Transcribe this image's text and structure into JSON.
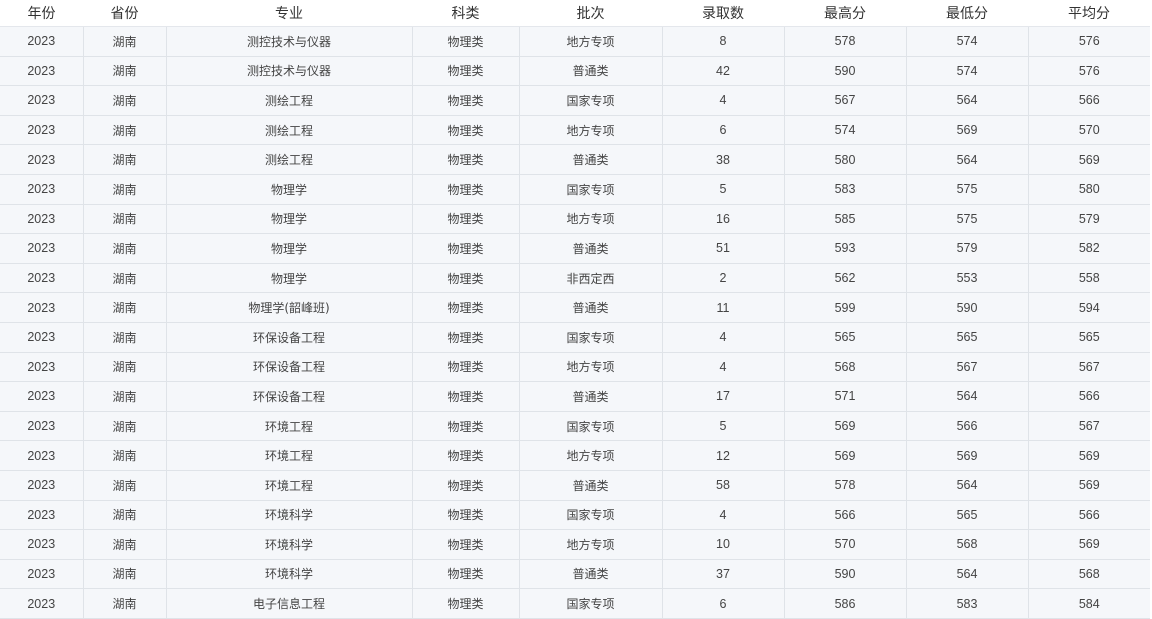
{
  "table": {
    "headers": [
      "年份",
      "省份",
      "专业",
      "科类",
      "批次",
      "录取数",
      "最高分",
      "最低分",
      "平均分"
    ],
    "rows": [
      [
        "2023",
        "湖南",
        "测控技术与仪器",
        "物理类",
        "地方专项",
        "8",
        "578",
        "574",
        "576"
      ],
      [
        "2023",
        "湖南",
        "测控技术与仪器",
        "物理类",
        "普通类",
        "42",
        "590",
        "574",
        "576"
      ],
      [
        "2023",
        "湖南",
        "测绘工程",
        "物理类",
        "国家专项",
        "4",
        "567",
        "564",
        "566"
      ],
      [
        "2023",
        "湖南",
        "测绘工程",
        "物理类",
        "地方专项",
        "6",
        "574",
        "569",
        "570"
      ],
      [
        "2023",
        "湖南",
        "测绘工程",
        "物理类",
        "普通类",
        "38",
        "580",
        "564",
        "569"
      ],
      [
        "2023",
        "湖南",
        "物理学",
        "物理类",
        "国家专项",
        "5",
        "583",
        "575",
        "580"
      ],
      [
        "2023",
        "湖南",
        "物理学",
        "物理类",
        "地方专项",
        "16",
        "585",
        "575",
        "579"
      ],
      [
        "2023",
        "湖南",
        "物理学",
        "物理类",
        "普通类",
        "51",
        "593",
        "579",
        "582"
      ],
      [
        "2023",
        "湖南",
        "物理学",
        "物理类",
        "非西定西",
        "2",
        "562",
        "553",
        "558"
      ],
      [
        "2023",
        "湖南",
        "物理学(韶峰班)",
        "物理类",
        "普通类",
        "11",
        "599",
        "590",
        "594"
      ],
      [
        "2023",
        "湖南",
        "环保设备工程",
        "物理类",
        "国家专项",
        "4",
        "565",
        "565",
        "565"
      ],
      [
        "2023",
        "湖南",
        "环保设备工程",
        "物理类",
        "地方专项",
        "4",
        "568",
        "567",
        "567"
      ],
      [
        "2023",
        "湖南",
        "环保设备工程",
        "物理类",
        "普通类",
        "17",
        "571",
        "564",
        "566"
      ],
      [
        "2023",
        "湖南",
        "环境工程",
        "物理类",
        "国家专项",
        "5",
        "569",
        "566",
        "567"
      ],
      [
        "2023",
        "湖南",
        "环境工程",
        "物理类",
        "地方专项",
        "12",
        "569",
        "569",
        "569"
      ],
      [
        "2023",
        "湖南",
        "环境工程",
        "物理类",
        "普通类",
        "58",
        "578",
        "564",
        "569"
      ],
      [
        "2023",
        "湖南",
        "环境科学",
        "物理类",
        "国家专项",
        "4",
        "566",
        "565",
        "566"
      ],
      [
        "2023",
        "湖南",
        "环境科学",
        "物理类",
        "地方专项",
        "10",
        "570",
        "568",
        "569"
      ],
      [
        "2023",
        "湖南",
        "环境科学",
        "物理类",
        "普通类",
        "37",
        "590",
        "564",
        "568"
      ],
      [
        "2023",
        "湖南",
        "电子信息工程",
        "物理类",
        "国家专项",
        "6",
        "586",
        "583",
        "584"
      ]
    ]
  }
}
